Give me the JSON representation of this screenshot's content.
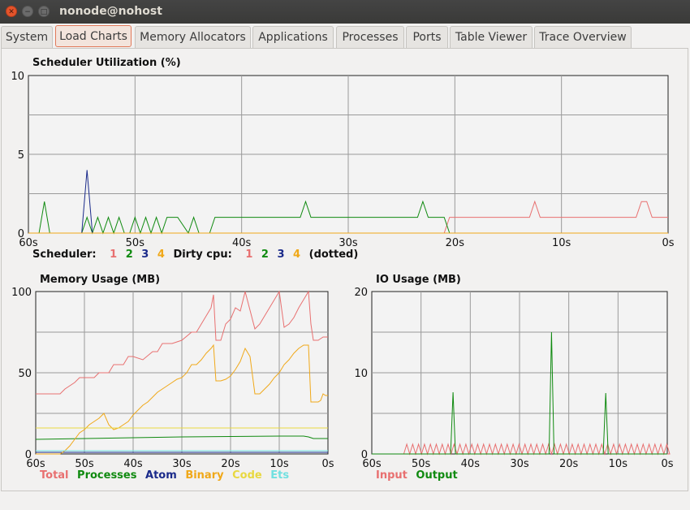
{
  "window": {
    "title": "nonode@nohost"
  },
  "tabs": [
    {
      "label": "System"
    },
    {
      "label": "Load Charts"
    },
    {
      "label": "Memory Allocators"
    },
    {
      "label": "Applications"
    },
    {
      "label": "Processes"
    },
    {
      "label": "Ports"
    },
    {
      "label": "Table Viewer"
    },
    {
      "label": "Trace Overview"
    }
  ],
  "active_tab": "Load Charts",
  "colors": {
    "s1": "#e87070",
    "s2": "#108a10",
    "s3": "#1a2a8a",
    "s4": "#f0a818",
    "code": "#e8d840",
    "ets": "#70e0e0",
    "grid": "#9a9a9a",
    "plot_bg": "#f3f3f3"
  },
  "scheduler_legend": {
    "prefix": "Scheduler:",
    "items": [
      "1",
      "2",
      "3",
      "4"
    ],
    "dirty_label": "Dirty cpu:",
    "dirty_items": [
      "1",
      "2",
      "3",
      "4"
    ],
    "suffix": "(dotted)"
  },
  "memory_legend": [
    "Total",
    "Processes",
    "Atom",
    "Binary",
    "Code",
    "Ets"
  ],
  "io_legend": [
    "Input",
    "Output"
  ],
  "chart_data": [
    {
      "type": "line",
      "title": "Scheduler Utilization (%)",
      "x_ticks": [
        "60s",
        "50s",
        "40s",
        "30s",
        "20s",
        "10s",
        "0s"
      ],
      "y_ticks": [
        "10",
        "5",
        "0"
      ],
      "ylim": [
        0,
        10
      ],
      "grid": true,
      "series": [
        {
          "name": "1",
          "x": [
            60,
            21,
            20.5,
            13,
            12.5,
            12,
            3,
            2.5,
            2,
            1.5,
            0
          ],
          "y": [
            0,
            0,
            1,
            1,
            2,
            1,
            1,
            2,
            2,
            1,
            1
          ]
        },
        {
          "name": "2",
          "x": [
            60,
            59,
            58.5,
            58,
            55,
            54.5,
            54,
            53.5,
            53,
            52.5,
            52,
            51.5,
            51,
            50.5,
            50,
            49.5,
            49,
            48.5,
            48,
            47.5,
            47,
            46.5,
            46,
            45,
            44.5,
            44,
            43,
            42.5,
            42,
            41.5,
            40,
            34.5,
            34,
            33.5,
            24,
            23.5,
            23,
            22.5,
            21,
            20.5,
            0
          ],
          "y": [
            0,
            0,
            2,
            0,
            0,
            1,
            0,
            1,
            0,
            1,
            0,
            1,
            0,
            0,
            1,
            0,
            1,
            0,
            1,
            0,
            1,
            1,
            1,
            0,
            1,
            0,
            0,
            1,
            1,
            1,
            1,
            1,
            2,
            1,
            1,
            1,
            2,
            1,
            1,
            0,
            0
          ]
        },
        {
          "name": "3",
          "x": [
            60,
            55,
            54.5,
            54,
            0
          ],
          "y": [
            0,
            0,
            4,
            0,
            0
          ]
        },
        {
          "name": "4",
          "x": [
            60,
            0
          ],
          "y": [
            0,
            0
          ]
        }
      ]
    },
    {
      "type": "line",
      "title": "Memory Usage (MB)",
      "x_ticks": [
        "60s",
        "50s",
        "40s",
        "30s",
        "20s",
        "10s",
        "0s"
      ],
      "y_ticks": [
        "100",
        "50",
        "0"
      ],
      "ylim": [
        0,
        100
      ],
      "grid": true,
      "series": [
        {
          "name": "Total",
          "x": [
            60,
            55,
            54,
            52,
            51,
            48,
            47,
            45,
            44,
            42,
            41,
            40,
            38,
            36,
            35,
            34,
            32,
            30,
            28,
            27,
            26,
            25,
            24,
            23.5,
            23,
            22,
            21,
            20,
            19,
            18,
            17,
            15,
            14,
            13,
            12,
            11,
            10,
            9,
            8,
            7,
            6,
            5,
            4,
            3.5,
            3,
            2,
            1.5,
            1,
            0.5,
            0
          ],
          "y": [
            37,
            37,
            40,
            44,
            47,
            47,
            50,
            50,
            55,
            55,
            60,
            60,
            58,
            63,
            63,
            68,
            68,
            70,
            75,
            75,
            80,
            85,
            90,
            98,
            70,
            70,
            80,
            83,
            90,
            88,
            100,
            77,
            80,
            85,
            90,
            95,
            100,
            78,
            80,
            84,
            90,
            95,
            100,
            80,
            70,
            70,
            71,
            72,
            72,
            72
          ]
        },
        {
          "name": "Processes",
          "x": [
            60,
            40,
            30,
            10,
            5,
            4,
            3,
            0
          ],
          "y": [
            9,
            10,
            10.5,
            11,
            11,
            10.5,
            9.5,
            9.5
          ]
        },
        {
          "name": "Atom",
          "x": [
            60,
            0
          ],
          "y": [
            1,
            1
          ]
        },
        {
          "name": "Binary",
          "x": [
            60,
            55,
            54,
            53,
            52,
            51,
            50,
            49,
            48,
            47,
            46,
            45,
            44,
            43,
            42,
            41,
            40,
            39,
            38,
            37,
            36,
            35,
            34,
            33,
            32,
            31,
            30,
            29,
            28,
            27,
            26,
            25,
            24,
            23.5,
            23,
            22,
            21,
            20,
            19,
            18,
            17,
            16,
            15,
            14,
            13,
            12,
            11,
            10,
            9,
            8,
            7,
            6,
            5,
            4,
            3.5,
            3,
            2,
            1.5,
            1,
            0.5,
            0
          ],
          "y": [
            0,
            0,
            2,
            5,
            9,
            13,
            15,
            18,
            20,
            22,
            25,
            18,
            15,
            16,
            18,
            20,
            24,
            27,
            30,
            32,
            35,
            38,
            40,
            42,
            44,
            46,
            47,
            50,
            55,
            55,
            58,
            62,
            65,
            67,
            45,
            45,
            46,
            48,
            52,
            57,
            65,
            60,
            37,
            37,
            40,
            43,
            47,
            50,
            55,
            58,
            62,
            65,
            67,
            67,
            32,
            32,
            32,
            33,
            37,
            36,
            36
          ]
        },
        {
          "name": "Code",
          "x": [
            60,
            0
          ],
          "y": [
            16,
            16
          ]
        },
        {
          "name": "Ets",
          "x": [
            60,
            0
          ],
          "y": [
            2,
            2
          ]
        }
      ]
    },
    {
      "type": "line",
      "title": "IO Usage (MB)",
      "x_ticks": [
        "60s",
        "50s",
        "40s",
        "30s",
        "20s",
        "10s",
        "0s"
      ],
      "y_ticks": [
        "20",
        "10",
        "0"
      ],
      "ylim": [
        0,
        20
      ],
      "grid": true,
      "series": [
        {
          "name": "Input",
          "pattern": "sawtooth",
          "x_start": 53.5,
          "x_end": 0.5,
          "period": 1.2,
          "peak": 1.2
        },
        {
          "name": "Output",
          "x": [
            60,
            44,
            43.5,
            43,
            24,
            23.5,
            23,
            13,
            12.5,
            12,
            0
          ],
          "y": [
            0,
            0,
            7.6,
            0,
            0,
            15,
            0,
            0,
            7.5,
            0,
            0
          ]
        }
      ]
    }
  ]
}
